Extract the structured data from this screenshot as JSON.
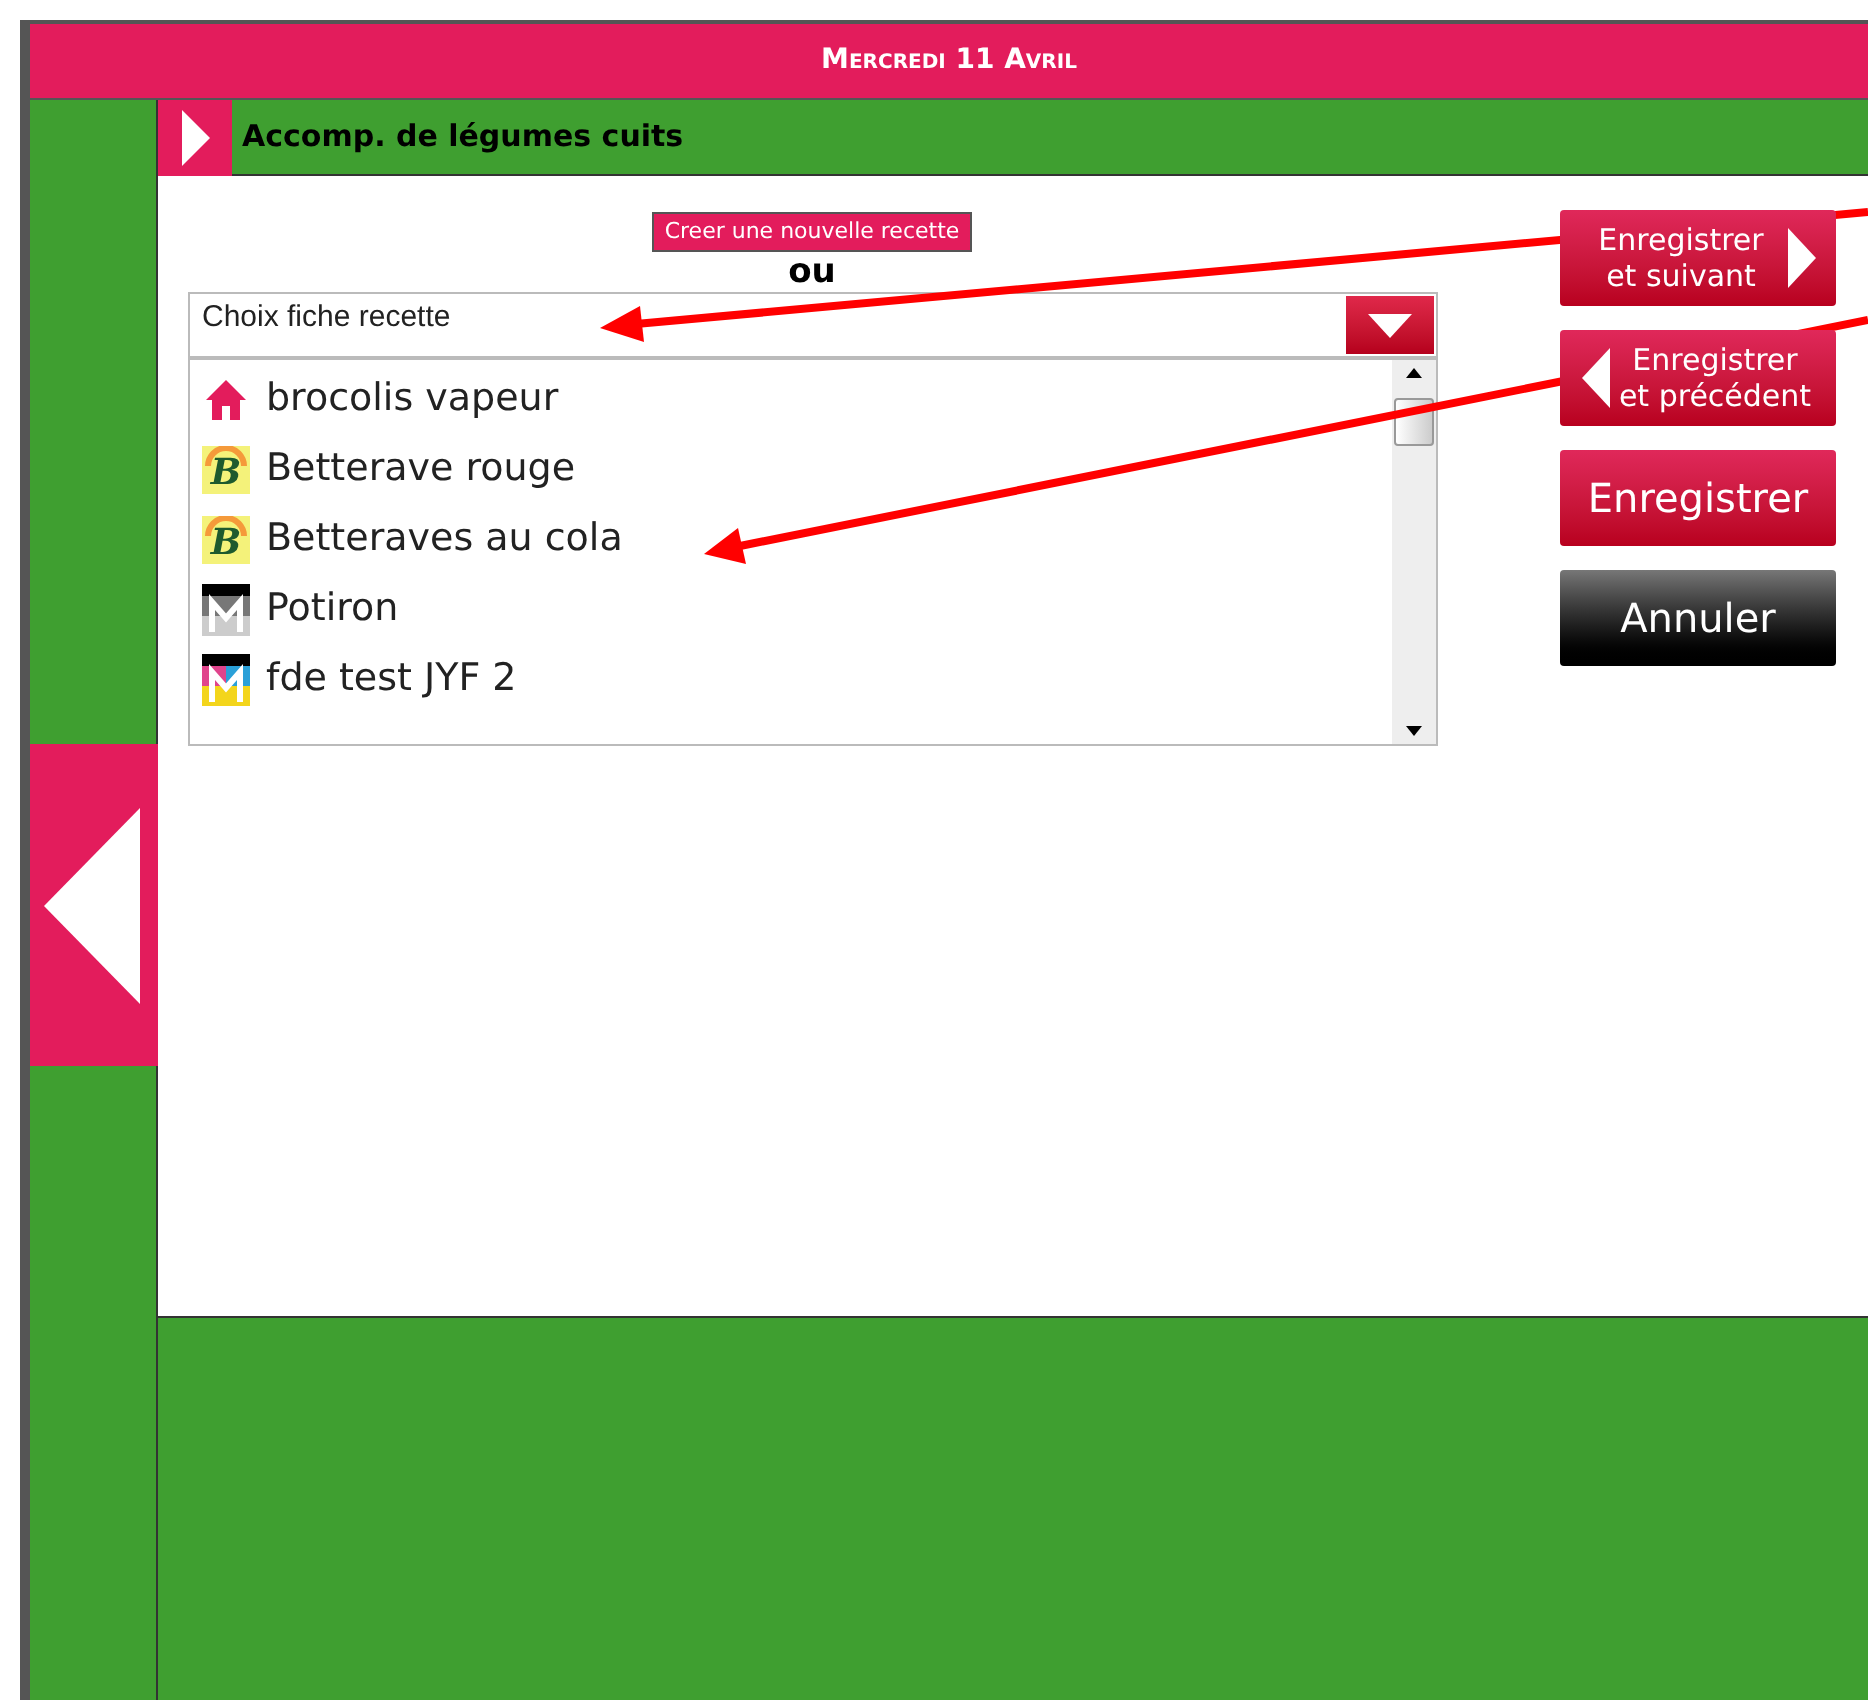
{
  "header": {
    "date": "Mercredi 11 Avril"
  },
  "section": {
    "title": "Accomp. de légumes cuits"
  },
  "create_button": "Creer une nouvelle recette",
  "separator": "ou",
  "recipe_select": {
    "placeholder": "Choix fiche recette"
  },
  "recipes": [
    {
      "label": "brocolis vapeur",
      "kind": "home"
    },
    {
      "label": "Betterave rouge",
      "kind": "bio",
      "icon_letter": "B"
    },
    {
      "label": "Betteraves au cola",
      "kind": "bio",
      "icon_letter": "B"
    },
    {
      "label": "Potiron",
      "kind": "com-grey"
    },
    {
      "label": "fde test JYF 2",
      "kind": "com-color"
    }
  ],
  "buttons": [
    {
      "label": "Enregistrer et suivant",
      "kind": "next"
    },
    {
      "label": "Enregistrer et précédent",
      "kind": "prev"
    },
    {
      "label": "Enregistrer",
      "kind": "save"
    },
    {
      "label": "Annuler",
      "kind": "cancel"
    }
  ]
}
